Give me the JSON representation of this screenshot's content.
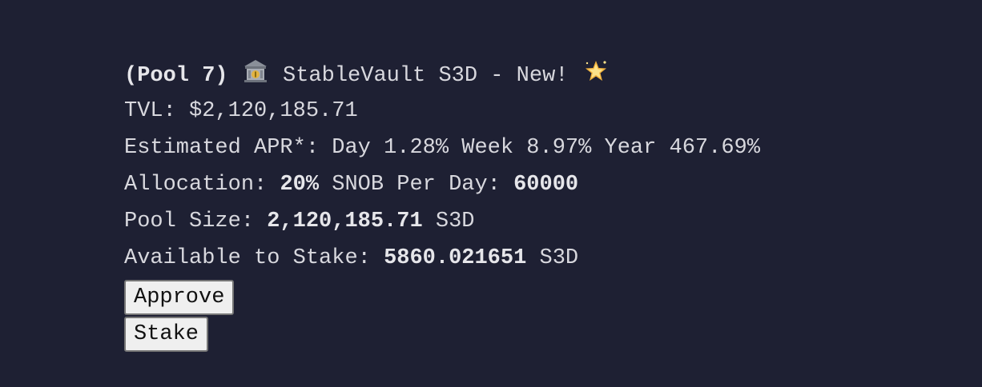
{
  "pool": {
    "prefix": "(Pool 7)",
    "icon_bank": "bank-emoji",
    "title": "StableVault S3D - New!",
    "icon_star": "glowing-star-emoji",
    "tvl_label": "TVL:",
    "tvl_value": "$2,120,185.71",
    "apr_label": "Estimated APR*:",
    "apr_day_label": "Day",
    "apr_day": "1.28%",
    "apr_week_label": "Week",
    "apr_week": "8.97%",
    "apr_year_label": "Year",
    "apr_year": "467.69%",
    "allocation_label": "Allocation:",
    "allocation_value": "20%",
    "snob_label": "SNOB Per Day:",
    "snob_value": "60000",
    "pool_size_label": "Pool Size:",
    "pool_size_value": "2,120,185.71",
    "pool_size_unit": "S3D",
    "available_label": "Available to Stake:",
    "available_value": "5860.021651",
    "available_unit": "S3D",
    "approve_label": "Approve",
    "stake_label": "Stake"
  },
  "colors": {
    "background": "#1e2033",
    "text": "#d8d8de"
  }
}
